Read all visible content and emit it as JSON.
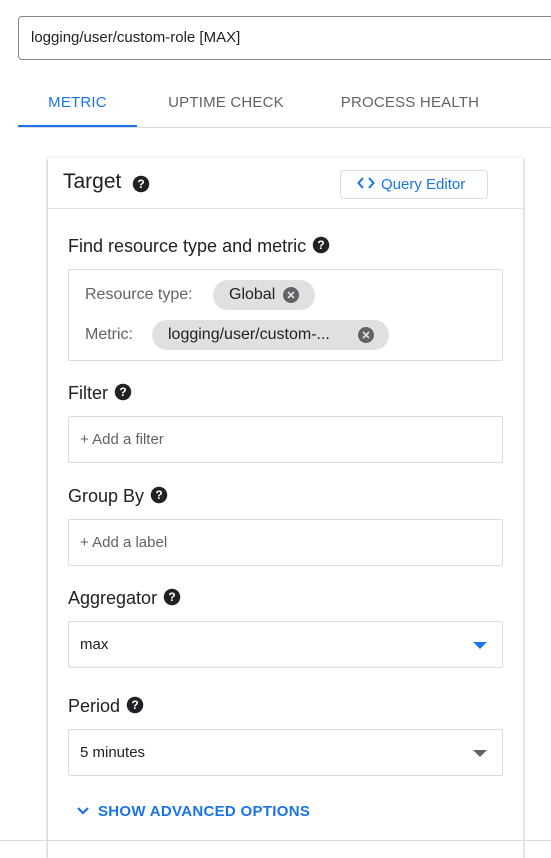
{
  "chart_name": {
    "value": "logging/user/custom-role [MAX]"
  },
  "tabs": [
    {
      "label": "METRIC",
      "active": true
    },
    {
      "label": "UPTIME CHECK",
      "active": false
    },
    {
      "label": "PROCESS HEALTH",
      "active": false
    }
  ],
  "target": {
    "title": "Target",
    "query_editor_label": "Query Editor",
    "find_label": "Find resource type and metric",
    "resource_type_label": "Resource type:",
    "resource_type_value": "Global",
    "metric_label": "Metric:",
    "metric_value": "logging/user/custom-...",
    "filter_label": "Filter",
    "filter_placeholder": "+ Add a filter",
    "group_by_label": "Group By",
    "group_by_placeholder": "+ Add a label",
    "aggregator_label": "Aggregator",
    "aggregator_value": "max",
    "period_label": "Period",
    "period_value": "5 minutes",
    "advanced_label": "SHOW ADVANCED OPTIONS"
  },
  "icons": {
    "help": "help-circle-icon",
    "code": "code-brackets-icon",
    "chip_remove": "cancel-circle-icon",
    "dropdown": "arrow-drop-down-icon",
    "expand": "chevron-down-icon"
  },
  "colors": {
    "accent": "#1a73e8",
    "text": "#202124",
    "secondary_text": "#5f6368",
    "border": "#dadce0",
    "chip_bg": "#e0e0e0"
  }
}
